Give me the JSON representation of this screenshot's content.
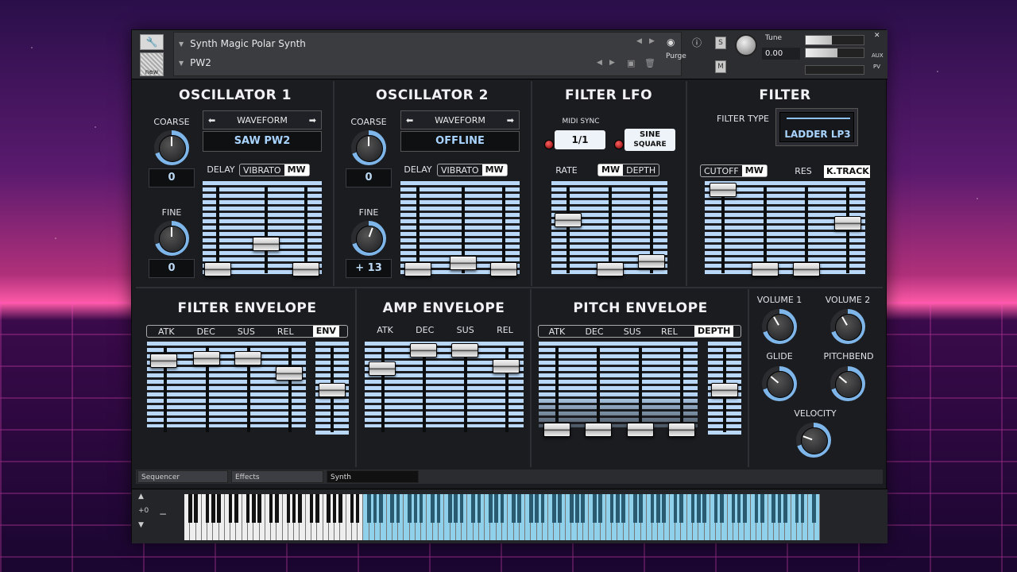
{
  "header": {
    "instrument_name": "Synth Magic Polar Synth",
    "preset_name": "PW2",
    "new_label": "new",
    "purge_label": "Purge",
    "s_label": "S",
    "m_label": "M",
    "tune_label": "Tune",
    "tune_value": "0.00",
    "aux_label": "AUX",
    "pv_label": "PV"
  },
  "osc1": {
    "title": "OSCILLATOR 1",
    "coarse_label": "COARSE",
    "coarse_value": "0",
    "fine_label": "FINE",
    "fine_value": "0",
    "waveform_label": "WAVEFORM",
    "waveform_value": "SAW PW2",
    "delay_label": "DELAY",
    "vibrato_label": "VIBRATO",
    "mw_label": "MW"
  },
  "osc2": {
    "title": "OSCILLATOR 2",
    "coarse_label": "COARSE",
    "coarse_value": "0",
    "fine_label": "FINE",
    "fine_value": "+ 13",
    "waveform_label": "WAVEFORM",
    "waveform_value": "OFFLINE",
    "delay_label": "DELAY",
    "vibrato_label": "VIBRATO",
    "mw_label": "MW"
  },
  "lfo": {
    "title": "FILTER LFO",
    "midi_sync_label": "MIDI SYNC",
    "sync_value": "1/1",
    "shape_sine": "SINE",
    "shape_square": "SQUARE",
    "rate_label": "RATE",
    "mw_label": "MW",
    "depth_label": "DEPTH"
  },
  "filter": {
    "title": "FILTER",
    "filter_type_label": "FILTER TYPE",
    "filter_type_value": "LADDER LP3",
    "cutoff_label": "CUTOFF",
    "mw_label": "MW",
    "res_label": "RES",
    "ktrack_label": "K.TRACK"
  },
  "filter_env": {
    "title": "FILTER ENVELOPE",
    "atk": "ATK",
    "dec": "DEC",
    "sus": "SUS",
    "rel": "REL",
    "env": "ENV"
  },
  "amp_env": {
    "title": "AMP ENVELOPE",
    "atk": "ATK",
    "dec": "DEC",
    "sus": "SUS",
    "rel": "REL"
  },
  "pitch_env": {
    "title": "PITCH ENVELOPE",
    "atk": "ATK",
    "dec": "DEC",
    "sus": "SUS",
    "rel": "REL",
    "depth": "DEPTH"
  },
  "master": {
    "volume1_label": "VOLUME 1",
    "volume2_label": "VOLUME 2",
    "glide_label": "GLIDE",
    "pitchbend_label": "PITCHBEND",
    "velocity_label": "VELOCITY"
  },
  "tabs": [
    "Sequencer",
    "Effects",
    "Synth"
  ],
  "keyboard": {
    "octave_label": "+0",
    "minus_label": "−"
  },
  "colors": {
    "accent_blue": "#b9d8f8",
    "panel": "#1a1c20",
    "knob_ring": "#7fb6ea"
  }
}
